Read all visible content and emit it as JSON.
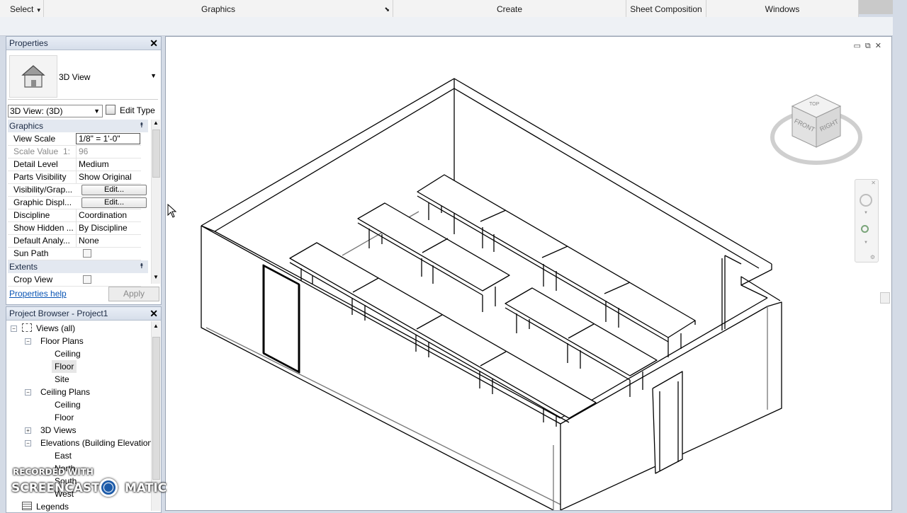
{
  "ribbon": {
    "select_label": "Select",
    "panels": [
      "Graphics",
      "Create",
      "Sheet Composition",
      "Windows"
    ]
  },
  "properties": {
    "title": "Properties",
    "type_name": "3D View",
    "view_selector": "3D View: (3D)",
    "edit_type_label": "Edit Type",
    "groups": {
      "graphics": "Graphics",
      "extents": "Extents"
    },
    "rows": [
      {
        "key": "View Scale",
        "value": "1/8\" = 1'-0\""
      },
      {
        "key": "Scale Value",
        "prefix": "1:",
        "value": "96"
      },
      {
        "key": "Detail Level",
        "value": "Medium"
      },
      {
        "key": "Parts Visibility",
        "value": "Show Original"
      },
      {
        "key": "Visibility/Grap...",
        "value": "Edit..."
      },
      {
        "key": "Graphic Displ...",
        "value": "Edit..."
      },
      {
        "key": "Discipline",
        "value": "Coordination"
      },
      {
        "key": "Show Hidden ...",
        "value": "By Discipline"
      },
      {
        "key": "Default Analy...",
        "value": "None"
      },
      {
        "key": "Sun Path",
        "value": ""
      }
    ],
    "crop_view": "Crop View",
    "help_link": "Properties help",
    "apply_label": "Apply"
  },
  "browser": {
    "title": "Project Browser - Project1",
    "items": [
      "Views (all)",
      "Floor Plans",
      "Ceiling",
      "Floor",
      "Site",
      "Ceiling Plans",
      "Ceiling",
      "Floor",
      "3D Views",
      "Elevations (Building Elevation",
      "East",
      "North",
      "South",
      "West",
      "Legends"
    ]
  },
  "viewcube": {
    "top": "TOP",
    "front": "FRONT",
    "right": "RIGHT"
  },
  "watermark": {
    "line1": "RECORDED WITH",
    "line2": "SCREENCAST",
    "line3": "MATIC"
  },
  "colors": {
    "panel_header": "#dde4ee",
    "selection": "#e6e6e6",
    "link": "#0a55b5"
  }
}
